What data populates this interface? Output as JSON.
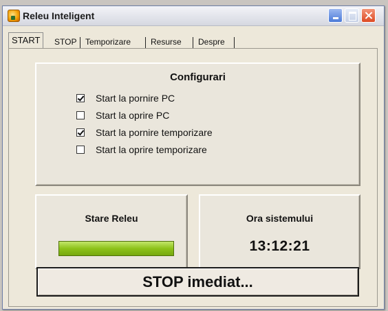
{
  "window": {
    "title": "Releu Inteligent",
    "icon": "relay-app-icon"
  },
  "tabs": [
    {
      "label": "START",
      "active": true
    },
    {
      "label": "STOP",
      "active": false
    },
    {
      "label": "Temporizare",
      "active": false
    },
    {
      "label": "Resurse",
      "active": false
    },
    {
      "label": "Despre",
      "active": false
    }
  ],
  "config": {
    "title": "Configurari",
    "options": [
      {
        "label": "Start la pornire PC",
        "checked": true
      },
      {
        "label": "Start la oprire PC",
        "checked": false
      },
      {
        "label": "Start la pornire temporizare",
        "checked": true
      },
      {
        "label": "Start la oprire temporizare",
        "checked": false
      }
    ]
  },
  "relay_state": {
    "title": "Stare Releu",
    "indicator_color": "#8dc21a"
  },
  "system_time": {
    "title": "Ora sistemului",
    "value": "13:12:21"
  },
  "stop_button": {
    "label": "STOP imediat..."
  },
  "colors": {
    "window_bg": "#ede8da",
    "close_button": "#dd4a24",
    "minimize_button": "#4b7ad8"
  }
}
